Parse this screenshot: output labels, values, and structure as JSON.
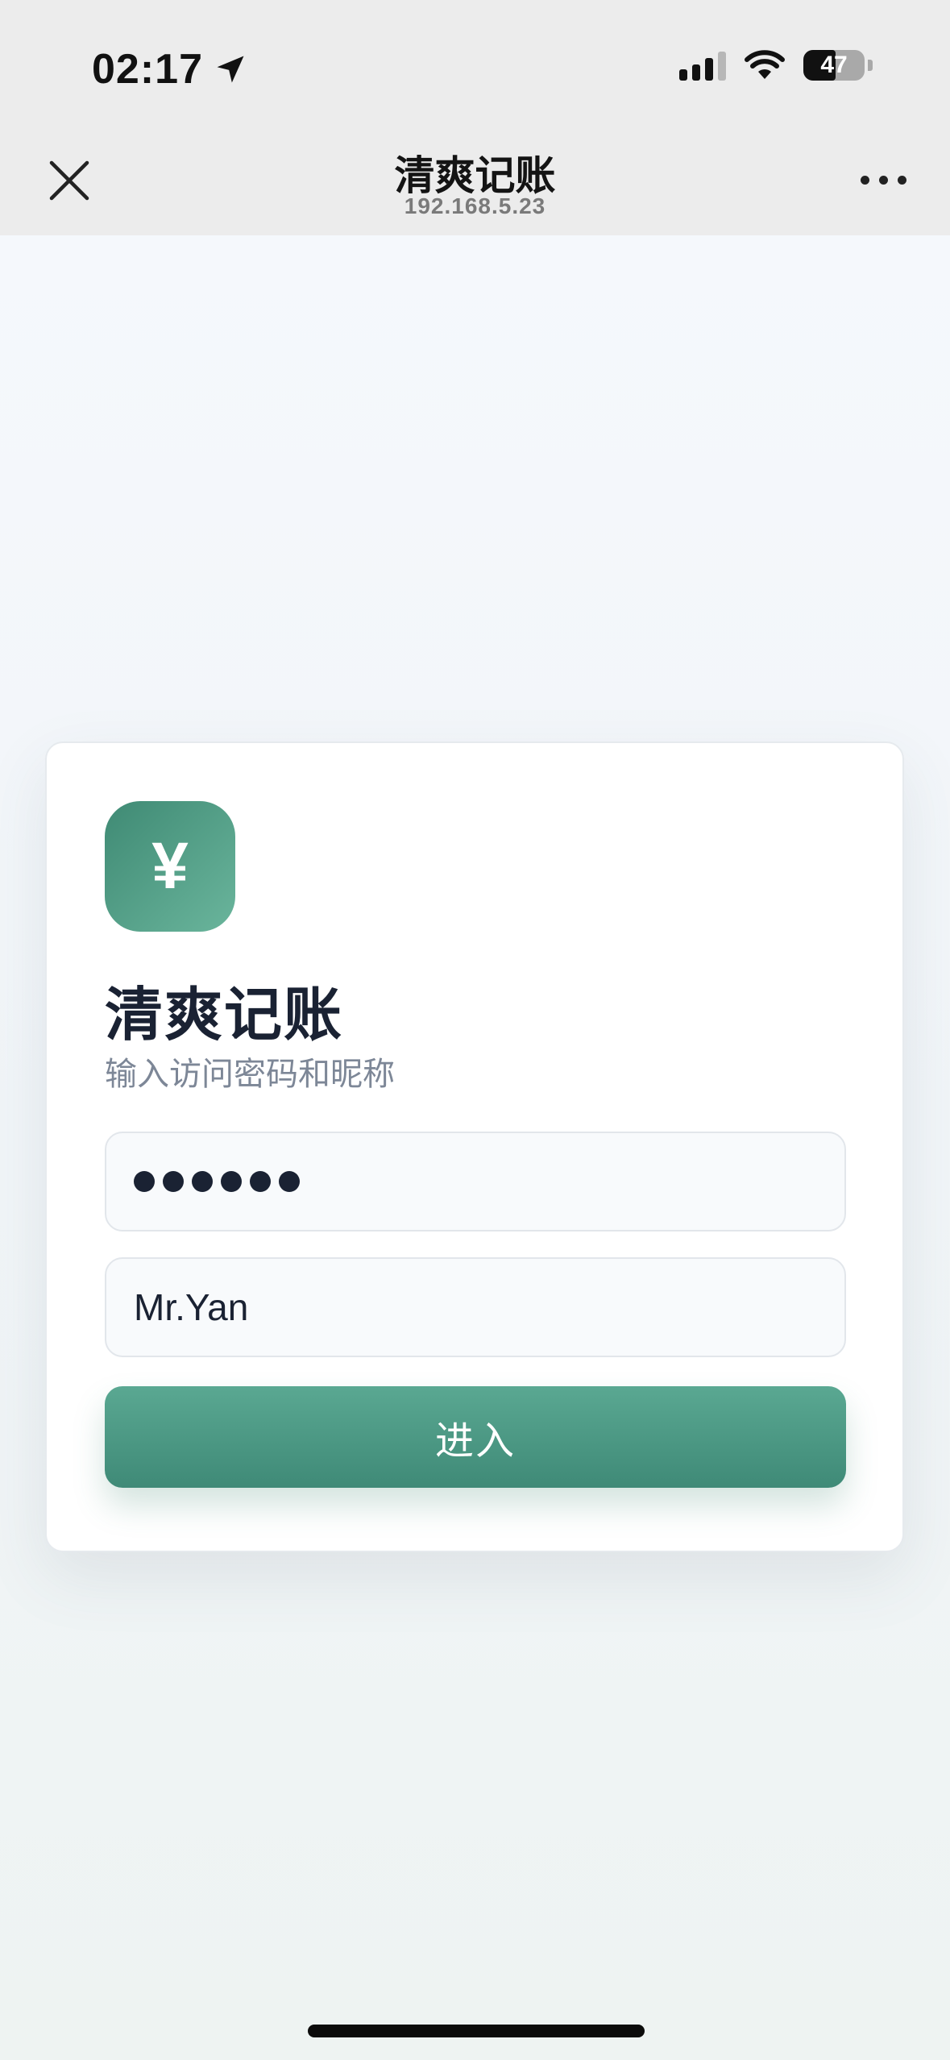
{
  "status_bar": {
    "time": "02:17",
    "battery": "47",
    "icons": [
      "location-arrow-icon",
      "cellular-signal-icon",
      "wifi-icon",
      "battery-icon"
    ]
  },
  "header": {
    "title": "清爽记账",
    "subtitle": "192.168.5.23",
    "icons": [
      "close-icon",
      "more-icon"
    ]
  },
  "login": {
    "logo_symbol": "¥",
    "title": "清爽记账",
    "subtitle": "输入访问密码和昵称",
    "password_dot_count": 6,
    "nickname_value": "Mr.Yan",
    "submit_label": "进入"
  },
  "colors": {
    "accent": "#4a9a83",
    "title_text": "#1a2233",
    "muted_text": "#7d8797"
  }
}
